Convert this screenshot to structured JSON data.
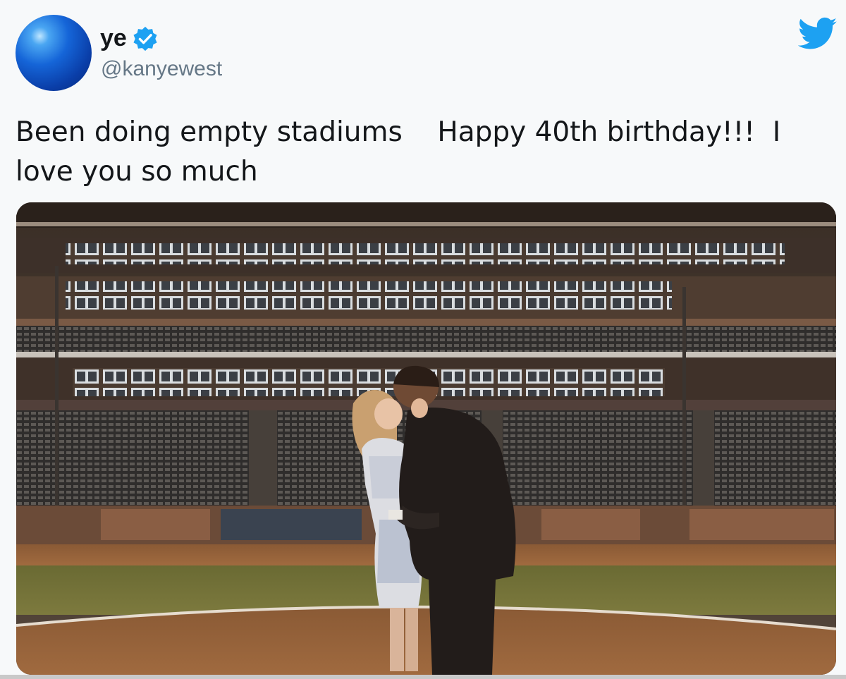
{
  "tweet": {
    "display_name": "ye",
    "handle": "@kanyewest",
    "text": "Been doing empty stadiums    Happy 40th birthday!!!  I love you so much",
    "verified_icon": "verified-badge-icon",
    "platform_icon": "twitter-bird-icon",
    "colors": {
      "twitter_blue": "#1da1f2",
      "text": "#14171a",
      "secondary": "#657786",
      "background": "#f7f9fa"
    }
  }
}
